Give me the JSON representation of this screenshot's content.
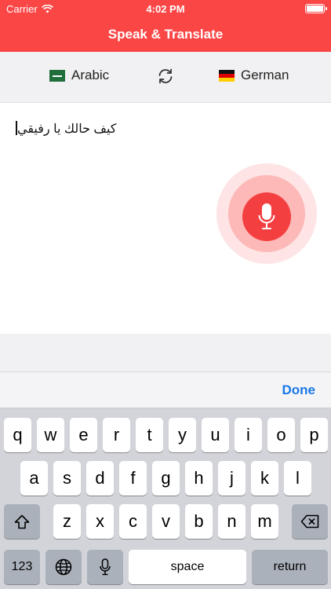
{
  "status_bar": {
    "carrier": "Carrier",
    "time": "4:02 PM"
  },
  "nav": {
    "title": "Speak & Translate"
  },
  "languages": {
    "source": "Arabic",
    "target": "German"
  },
  "input": {
    "text": "كيف حالك يا رفيقي"
  },
  "accessory": {
    "done_label": "Done"
  },
  "keyboard": {
    "row1": [
      "q",
      "w",
      "e",
      "r",
      "t",
      "y",
      "u",
      "i",
      "o",
      "p"
    ],
    "row2": [
      "a",
      "s",
      "d",
      "f",
      "g",
      "h",
      "j",
      "k",
      "l"
    ],
    "row3": [
      "z",
      "x",
      "c",
      "v",
      "b",
      "n",
      "m"
    ],
    "numbers_label": "123",
    "space_label": "space",
    "return_label": "return"
  },
  "colors": {
    "accent": "#fb4646",
    "mic": "#f43f41",
    "link": "#1a78ea"
  },
  "icons": [
    "wifi-icon",
    "battery-icon",
    "sync-icon",
    "microphone-icon",
    "shift-icon",
    "delete-icon",
    "globe-icon",
    "dictation-icon"
  ]
}
